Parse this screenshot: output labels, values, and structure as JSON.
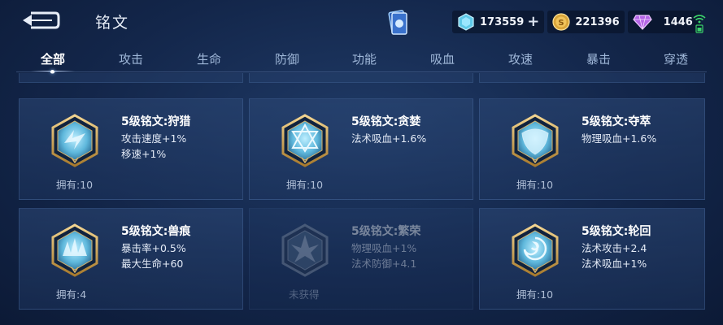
{
  "header": {
    "title": "铭文",
    "currencies": [
      {
        "icon": "diamond-icon",
        "value": "173559",
        "plus": "+"
      },
      {
        "icon": "gold-coin-icon",
        "value": "221396"
      },
      {
        "icon": "gem-icon",
        "value": "1446"
      }
    ]
  },
  "tabs": [
    {
      "label": "全部",
      "active": true
    },
    {
      "label": "攻击"
    },
    {
      "label": "生命"
    },
    {
      "label": "防御"
    },
    {
      "label": "功能"
    },
    {
      "label": "吸血"
    },
    {
      "label": "攻速"
    },
    {
      "label": "暴击"
    },
    {
      "label": "穿透"
    }
  ],
  "cards": [
    {
      "name": "5级铭文:狩猎",
      "attrs": [
        "攻击速度+1%",
        "移速+1%"
      ],
      "owned": "拥有:10",
      "icon": "hunt-rune-icon",
      "owned_flag": true
    },
    {
      "name": "5级铭文:贪婪",
      "attrs": [
        "法术吸血+1.6%"
      ],
      "owned": "拥有:10",
      "icon": "greed-rune-icon",
      "owned_flag": true
    },
    {
      "name": "5级铭文:夺萃",
      "attrs": [
        "物理吸血+1.6%"
      ],
      "owned": "拥有:10",
      "icon": "extract-rune-icon",
      "owned_flag": true
    },
    {
      "name": "5级铭文:兽痕",
      "attrs": [
        "暴击率+0.5%",
        "最大生命+60"
      ],
      "owned": "拥有:4",
      "icon": "beast-rune-icon",
      "owned_flag": true
    },
    {
      "name": "5级铭文:繁荣",
      "attrs": [
        "物理吸血+1%",
        "法术防御+4.1"
      ],
      "owned": "未获得",
      "icon": "prosper-rune-icon",
      "owned_flag": false
    },
    {
      "name": "5级铭文:轮回",
      "attrs": [
        "法术攻击+2.4",
        "法术吸血+1%"
      ],
      "owned": "拥有:10",
      "icon": "cycle-rune-icon",
      "owned_flag": true
    }
  ],
  "colors": {
    "accent": "#cfe0ff",
    "gold": "#d8b36a",
    "rune_blue": "#7fd0f0"
  }
}
